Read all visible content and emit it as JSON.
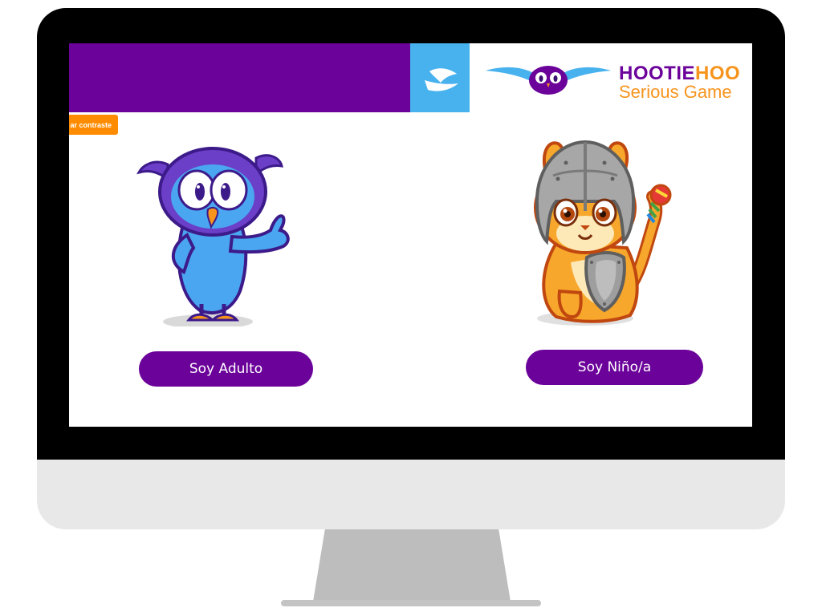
{
  "header": {
    "brand_part1": "HOOTIE",
    "brand_part2": "HOO",
    "brand_subtitle": "Serious Game",
    "logo_icon": "owl-logo-icon",
    "bird_icon": "bird-icon"
  },
  "toolbar": {
    "contrast_label": "ar contraste"
  },
  "choices": {
    "adult": {
      "label": "Soy Adulto",
      "illustration": "owl-mascot-icon"
    },
    "child": {
      "label": "Soy Niño/a",
      "illustration": "lion-knight-mascot-icon"
    }
  },
  "colors": {
    "purple": "#6b029a",
    "blue": "#48b2ef",
    "orange": "#ff8c00"
  }
}
